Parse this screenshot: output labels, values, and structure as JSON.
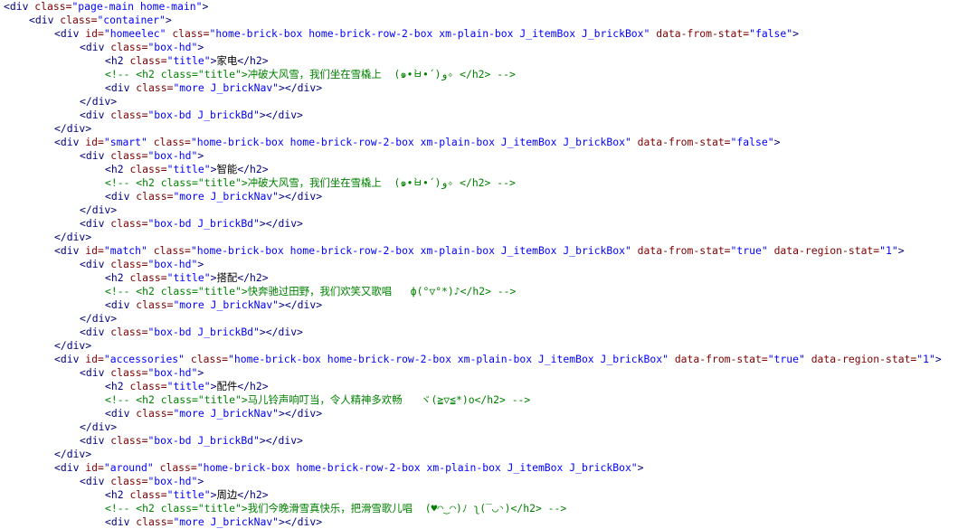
{
  "source_lines": [
    {
      "indent": 0,
      "segs": [
        [
          "tag",
          "<div "
        ],
        [
          "attr-name",
          "class="
        ],
        [
          "attr-val",
          "\"page-main home-main\""
        ],
        [
          "tag",
          ">"
        ]
      ]
    },
    {
      "indent": 1,
      "segs": [
        [
          "tag",
          "<div "
        ],
        [
          "attr-name",
          "class="
        ],
        [
          "attr-val",
          "\"container\""
        ],
        [
          "tag",
          ">"
        ]
      ]
    },
    {
      "indent": 2,
      "segs": [
        [
          "tag",
          "<div "
        ],
        [
          "attr-name",
          "id="
        ],
        [
          "attr-val",
          "\"homeelec\" "
        ],
        [
          "attr-name",
          "class="
        ],
        [
          "attr-val",
          "\"home-brick-box home-brick-row-2-box xm-plain-box J_itemBox J_brickBox\" "
        ],
        [
          "attr-name",
          "data-from-stat="
        ],
        [
          "attr-val",
          "\"false\""
        ],
        [
          "tag",
          ">"
        ]
      ]
    },
    {
      "indent": 3,
      "segs": [
        [
          "tag",
          "<div "
        ],
        [
          "attr-name",
          "class="
        ],
        [
          "attr-val",
          "\"box-hd\""
        ],
        [
          "tag",
          ">"
        ]
      ]
    },
    {
      "indent": 4,
      "segs": [
        [
          "tag",
          "<h2 "
        ],
        [
          "attr-name",
          "class="
        ],
        [
          "attr-val",
          "\"title\""
        ],
        [
          "tag",
          ">"
        ],
        [
          "text",
          "家电"
        ],
        [
          "tag",
          "</h2>"
        ]
      ]
    },
    {
      "indent": 4,
      "segs": [
        [
          "comment",
          "<!-- <h2 class=\"title\">冲破大风雪，我们坐在雪橇上  (๑•̀ㅂ•́)و✧ </h2> -->"
        ]
      ]
    },
    {
      "indent": 4,
      "segs": [
        [
          "tag",
          "<div "
        ],
        [
          "attr-name",
          "class="
        ],
        [
          "attr-val",
          "\"more J_brickNav\""
        ],
        [
          "tag",
          "></div>"
        ]
      ]
    },
    {
      "indent": 3,
      "segs": [
        [
          "tag",
          "</div>"
        ]
      ]
    },
    {
      "indent": 3,
      "segs": [
        [
          "tag",
          "<div "
        ],
        [
          "attr-name",
          "class="
        ],
        [
          "attr-val",
          "\"box-bd J_brickBd\""
        ],
        [
          "tag",
          "></div>"
        ]
      ]
    },
    {
      "indent": 2,
      "segs": [
        [
          "tag",
          "</div>"
        ]
      ]
    },
    {
      "indent": 2,
      "segs": [
        [
          "tag",
          "<div "
        ],
        [
          "attr-name",
          "id="
        ],
        [
          "attr-val",
          "\"smart\" "
        ],
        [
          "attr-name",
          "class="
        ],
        [
          "attr-val",
          "\"home-brick-box home-brick-row-2-box xm-plain-box J_itemBox J_brickBox\" "
        ],
        [
          "attr-name",
          "data-from-stat="
        ],
        [
          "attr-val",
          "\"false\""
        ],
        [
          "tag",
          ">"
        ]
      ]
    },
    {
      "indent": 3,
      "segs": [
        [
          "tag",
          "<div "
        ],
        [
          "attr-name",
          "class="
        ],
        [
          "attr-val",
          "\"box-hd\""
        ],
        [
          "tag",
          ">"
        ]
      ]
    },
    {
      "indent": 4,
      "segs": [
        [
          "tag",
          "<h2 "
        ],
        [
          "attr-name",
          "class="
        ],
        [
          "attr-val",
          "\"title\""
        ],
        [
          "tag",
          ">"
        ],
        [
          "text",
          "智能"
        ],
        [
          "tag",
          "</h2>"
        ]
      ]
    },
    {
      "indent": 4,
      "segs": [
        [
          "comment",
          "<!-- <h2 class=\"title\">冲破大风雪，我们坐在雪橇上  (๑•̀ㅂ•́)و✧ </h2> -->"
        ]
      ]
    },
    {
      "indent": 4,
      "segs": [
        [
          "tag",
          "<div "
        ],
        [
          "attr-name",
          "class="
        ],
        [
          "attr-val",
          "\"more J_brickNav\""
        ],
        [
          "tag",
          "></div>"
        ]
      ]
    },
    {
      "indent": 3,
      "segs": [
        [
          "tag",
          "</div>"
        ]
      ]
    },
    {
      "indent": 3,
      "segs": [
        [
          "tag",
          "<div "
        ],
        [
          "attr-name",
          "class="
        ],
        [
          "attr-val",
          "\"box-bd J_brickBd\""
        ],
        [
          "tag",
          "></div>"
        ]
      ]
    },
    {
      "indent": 2,
      "segs": [
        [
          "tag",
          "</div>"
        ]
      ]
    },
    {
      "indent": 2,
      "segs": [
        [
          "tag",
          "<div "
        ],
        [
          "attr-name",
          "id="
        ],
        [
          "attr-val",
          "\"match\" "
        ],
        [
          "attr-name",
          "class="
        ],
        [
          "attr-val",
          "\"home-brick-box home-brick-row-2-box xm-plain-box J_itemBox J_brickBox\" "
        ],
        [
          "attr-name",
          "data-from-stat="
        ],
        [
          "attr-val",
          "\"true\" "
        ],
        [
          "attr-name",
          "data-region-stat="
        ],
        [
          "attr-val",
          "\"1\""
        ],
        [
          "tag",
          ">"
        ]
      ]
    },
    {
      "indent": 3,
      "segs": [
        [
          "tag",
          "<div "
        ],
        [
          "attr-name",
          "class="
        ],
        [
          "attr-val",
          "\"box-hd\""
        ],
        [
          "tag",
          ">"
        ]
      ]
    },
    {
      "indent": 4,
      "segs": [
        [
          "tag",
          "<h2 "
        ],
        [
          "attr-name",
          "class="
        ],
        [
          "attr-val",
          "\"title\""
        ],
        [
          "tag",
          ">"
        ],
        [
          "text",
          "搭配"
        ],
        [
          "tag",
          "</h2>"
        ]
      ]
    },
    {
      "indent": 4,
      "segs": [
        [
          "comment",
          "<!-- <h2 class=\"title\">快奔驰过田野，我们欢笑又歌唱   ф(°▽°*)♪</h2> -->"
        ]
      ]
    },
    {
      "indent": 4,
      "segs": [
        [
          "tag",
          "<div "
        ],
        [
          "attr-name",
          "class="
        ],
        [
          "attr-val",
          "\"more J_brickNav\""
        ],
        [
          "tag",
          "></div>"
        ]
      ]
    },
    {
      "indent": 3,
      "segs": [
        [
          "tag",
          "</div>"
        ]
      ]
    },
    {
      "indent": 3,
      "segs": [
        [
          "tag",
          "<div "
        ],
        [
          "attr-name",
          "class="
        ],
        [
          "attr-val",
          "\"box-bd J_brickBd\""
        ],
        [
          "tag",
          "></div>"
        ]
      ]
    },
    {
      "indent": 2,
      "segs": [
        [
          "tag",
          "</div>"
        ]
      ]
    },
    {
      "indent": 2,
      "segs": [
        [
          "tag",
          "<div "
        ],
        [
          "attr-name",
          "id="
        ],
        [
          "attr-val",
          "\"accessories\" "
        ],
        [
          "attr-name",
          "class="
        ],
        [
          "attr-val",
          "\"home-brick-box home-brick-row-2-box xm-plain-box J_itemBox J_brickBox\" "
        ],
        [
          "attr-name",
          "data-from-stat="
        ],
        [
          "attr-val",
          "\"true\" "
        ],
        [
          "attr-name",
          "data-region-stat="
        ],
        [
          "attr-val",
          "\"1\""
        ],
        [
          "tag",
          ">"
        ]
      ]
    },
    {
      "indent": 3,
      "segs": [
        [
          "tag",
          "<div "
        ],
        [
          "attr-name",
          "class="
        ],
        [
          "attr-val",
          "\"box-hd\""
        ],
        [
          "tag",
          ">"
        ]
      ]
    },
    {
      "indent": 4,
      "segs": [
        [
          "tag",
          "<h2 "
        ],
        [
          "attr-name",
          "class="
        ],
        [
          "attr-val",
          "\"title\""
        ],
        [
          "tag",
          ">"
        ],
        [
          "text",
          "配件"
        ],
        [
          "tag",
          "</h2>"
        ]
      ]
    },
    {
      "indent": 4,
      "segs": [
        [
          "comment",
          "<!-- <h2 class=\"title\">马儿铃声响叮当，令人精神多欢畅   ヾ(≧▽≦*)o</h2> -->"
        ]
      ]
    },
    {
      "indent": 4,
      "segs": [
        [
          "tag",
          "<div "
        ],
        [
          "attr-name",
          "class="
        ],
        [
          "attr-val",
          "\"more J_brickNav\""
        ],
        [
          "tag",
          "></div>"
        ]
      ]
    },
    {
      "indent": 3,
      "segs": [
        [
          "tag",
          "</div>"
        ]
      ]
    },
    {
      "indent": 3,
      "segs": [
        [
          "tag",
          "<div "
        ],
        [
          "attr-name",
          "class="
        ],
        [
          "attr-val",
          "\"box-bd J_brickBd\""
        ],
        [
          "tag",
          "></div>"
        ]
      ]
    },
    {
      "indent": 2,
      "segs": [
        [
          "tag",
          "</div>"
        ]
      ]
    },
    {
      "indent": 2,
      "segs": [
        [
          "tag",
          "<div "
        ],
        [
          "attr-name",
          "id="
        ],
        [
          "attr-val",
          "\"around\" "
        ],
        [
          "attr-name",
          "class="
        ],
        [
          "attr-val",
          "\"home-brick-box home-brick-row-2-box xm-plain-box J_itemBox J_brickBox\""
        ],
        [
          "tag",
          ">"
        ]
      ]
    },
    {
      "indent": 3,
      "segs": [
        [
          "tag",
          "<div "
        ],
        [
          "attr-name",
          "class="
        ],
        [
          "attr-val",
          "\"box-hd\""
        ],
        [
          "tag",
          ">"
        ]
      ]
    },
    {
      "indent": 4,
      "segs": [
        [
          "tag",
          "<h2 "
        ],
        [
          "attr-name",
          "class="
        ],
        [
          "attr-val",
          "\"title\""
        ],
        [
          "tag",
          ">"
        ],
        [
          "text",
          "周边"
        ],
        [
          "tag",
          "</h2>"
        ]
      ]
    },
    {
      "indent": 4,
      "segs": [
        [
          "comment",
          "<!-- <h2 class=\"title\">我们今晚滑雪真快乐，把滑雪歌儿唱  (♥◠‿◠)ﾉ ʅ(‾◡◝)</h2> -->"
        ]
      ]
    },
    {
      "indent": 4,
      "segs": [
        [
          "tag",
          "<div "
        ],
        [
          "attr-name",
          "class="
        ],
        [
          "attr-val",
          "\"more J_brickNav\""
        ],
        [
          "tag",
          "></div>"
        ]
      ]
    }
  ]
}
